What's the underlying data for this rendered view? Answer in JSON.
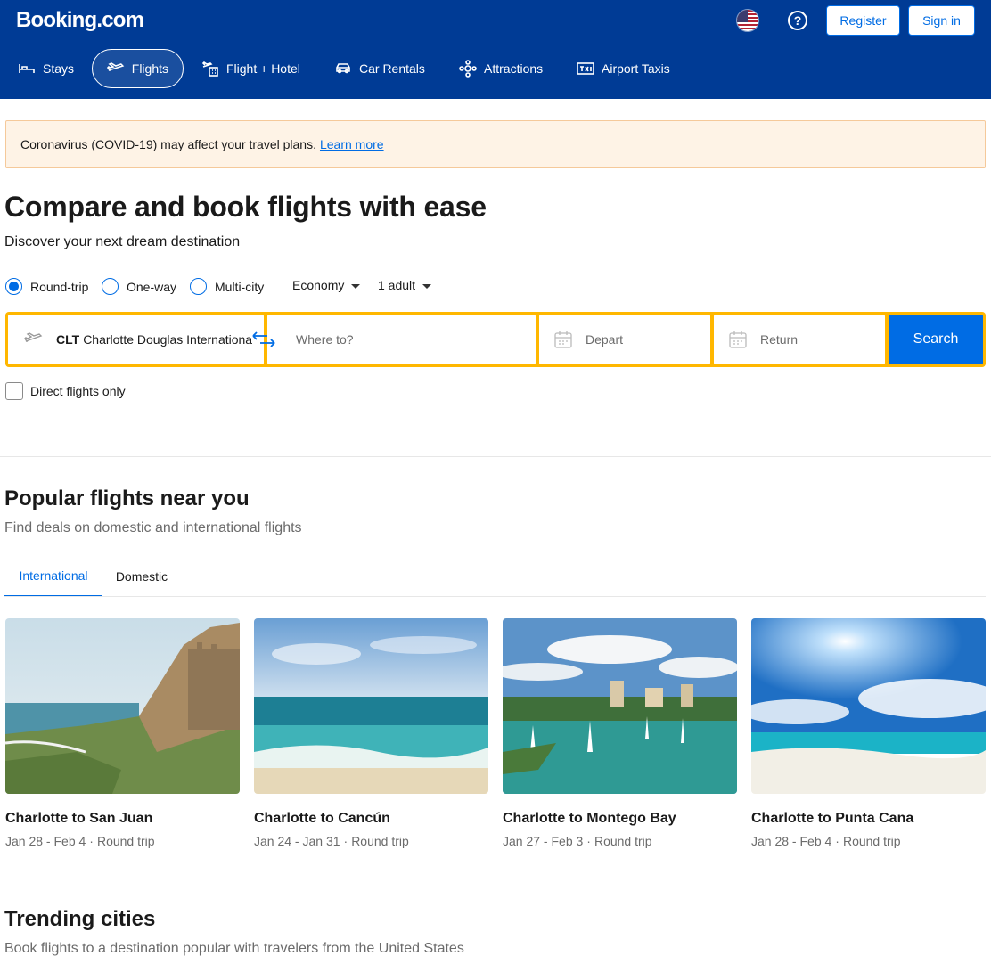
{
  "header": {
    "logo": "Booking.com",
    "register_label": "Register",
    "signin_label": "Sign in",
    "help_glyph": "?",
    "flag_icon": "us-flag-icon"
  },
  "nav": {
    "items": [
      {
        "label": "Stays",
        "icon": "bed-icon",
        "active": false
      },
      {
        "label": "Flights",
        "icon": "plane-icon",
        "active": true
      },
      {
        "label": "Flight + Hotel",
        "icon": "plane-hotel-icon",
        "active": false
      },
      {
        "label": "Car Rentals",
        "icon": "car-icon",
        "active": false
      },
      {
        "label": "Attractions",
        "icon": "attractions-icon",
        "active": false
      },
      {
        "label": "Airport Taxis",
        "icon": "taxi-icon",
        "active": false
      }
    ]
  },
  "banner": {
    "text": "Coronavirus (COVID-19) may affect your travel plans.",
    "link": "Learn more"
  },
  "hero": {
    "title": "Compare and book flights with ease",
    "subtitle": "Discover your next dream destination"
  },
  "trip_options": {
    "round_trip": "Round-trip",
    "one_way": "One-way",
    "multi_city": "Multi-city",
    "selected": "Round-trip",
    "cabin": "Economy",
    "travelers": "1 adult"
  },
  "search": {
    "from_code": "CLT",
    "from_name": "Charlotte Douglas International Airport",
    "to_placeholder": "Where to?",
    "depart_placeholder": "Depart",
    "return_placeholder": "Return",
    "button": "Search",
    "direct_only": "Direct flights only"
  },
  "popular": {
    "title": "Popular flights near you",
    "subtitle": "Find deals on domestic and international flights",
    "tabs": [
      "International",
      "Domestic"
    ],
    "active_tab": "International",
    "cards": [
      {
        "title": "Charlotte to San Juan",
        "dates": "Jan 28 - Feb 4",
        "trip": "Round trip"
      },
      {
        "title": "Charlotte to Cancún",
        "dates": "Jan 24 - Jan 31",
        "trip": "Round trip"
      },
      {
        "title": "Charlotte to Montego Bay",
        "dates": "Jan 27 - Feb 3",
        "trip": "Round trip"
      },
      {
        "title": "Charlotte to Punta Cana",
        "dates": "Jan 28 - Feb 4",
        "trip": "Round trip"
      }
    ]
  },
  "trending": {
    "title": "Trending cities",
    "subtitle": "Book flights to a destination popular with travelers from the United States"
  },
  "colors": {
    "brand": "#003b95",
    "accent": "#006ce4",
    "search_border": "#ffb700",
    "banner_bg": "#fef3e6"
  }
}
